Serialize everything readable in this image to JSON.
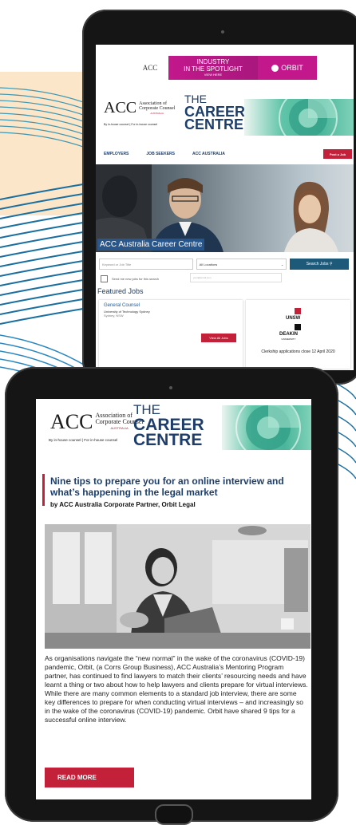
{
  "brand": {
    "navy": "#1d3d6b",
    "red": "#c3203a",
    "teal": "#4ab59b",
    "magenta": "#c2188c"
  },
  "ad": {
    "acc": "ACC",
    "spotlight_line1": "INDUSTRY",
    "spotlight_line2": "IN THE SPOTLIGHT",
    "spotlight_line3": "VIEW HERE",
    "orbit": "ORBIT"
  },
  "logo": {
    "mark": "ACC",
    "line1": "Association of",
    "line2": "Corporate Counsel",
    "country": "AUSTRALIA",
    "tagline": "By in-house counsel | For in-house counsel"
  },
  "career_centre": {
    "the": "THE",
    "career": "CAREER",
    "centre": "CENTRE"
  },
  "nav": {
    "employers": "EMPLOYERS",
    "job_seekers": "JOB SEEKERS",
    "acc_australia": "ACC AUSTRALIA",
    "post_job": "Post a Job"
  },
  "hero": {
    "caption": "ACC Australia Career Centre"
  },
  "search": {
    "keyword_placeholder": "Keyword or Job Title",
    "location": "All Locations",
    "button": "Search Jobs",
    "alert_label": "Send me new jobs for this search",
    "email_placeholder": "your@email.com"
  },
  "featured": {
    "heading": "Featured Jobs",
    "job_title": "General Counsel",
    "job_org": "University of Technology Sydney",
    "job_location": "Sydney, NSW",
    "view_all": "View All Jobs",
    "unsw": "UNSW",
    "deakin": "DEAKIN",
    "deakin_sub": "UNIVERSITY",
    "clerkship": "Clerkship applications close 12 April 2020"
  },
  "article": {
    "title": "Nine tips to prepare you for an online interview and what’s happening in the legal market",
    "byline": "by ACC Australia Corporate Partner, Orbit Legal",
    "body": "As organisations navigate the “new normal” in the wake of the coronavirus (COVID-19) pandemic, Orbit, (a Corrs Group Business), ACC Australia’s Mentoring Program partner, has continued to find lawyers to match their clients’ resourcing needs and have learnt a thing or two about how to help lawyers and clients prepare for virtual interviews. While there are many common elements to a standard job interview, there are some key differences to prepare for when conducting virtual interviews – and increasingly so in the wake of the coronavirus (COVID-19) pandemic. Orbit have shared 9 tips for a successful online interview.",
    "read_more": "READ MORE"
  }
}
